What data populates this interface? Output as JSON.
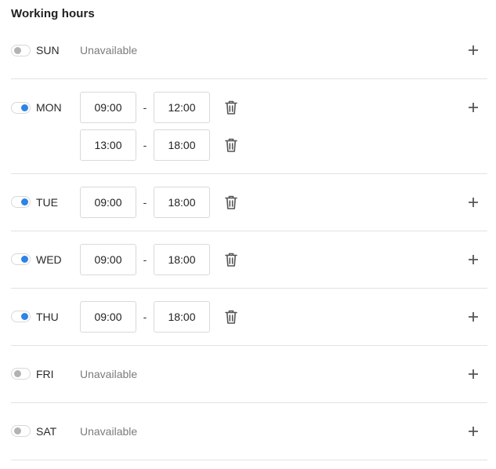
{
  "header": {
    "title": "Working hours"
  },
  "days": [
    {
      "label": "SUN",
      "enabled": false,
      "unavailable_text": "Unavailable",
      "slots": []
    },
    {
      "label": "MON",
      "enabled": true,
      "slots": [
        {
          "start": "09:00",
          "separator": "-",
          "end": "12:00"
        },
        {
          "start": "13:00",
          "separator": "-",
          "end": "18:00"
        }
      ]
    },
    {
      "label": "TUE",
      "enabled": true,
      "slots": [
        {
          "start": "09:00",
          "separator": "-",
          "end": "18:00"
        }
      ]
    },
    {
      "label": "WED",
      "enabled": true,
      "slots": [
        {
          "start": "09:00",
          "separator": "-",
          "end": "18:00"
        }
      ]
    },
    {
      "label": "THU",
      "enabled": true,
      "slots": [
        {
          "start": "09:00",
          "separator": "-",
          "end": "18:00"
        }
      ]
    },
    {
      "label": "FRI",
      "enabled": false,
      "unavailable_text": "Unavailable",
      "slots": []
    },
    {
      "label": "SAT",
      "enabled": false,
      "unavailable_text": "Unavailable",
      "slots": []
    }
  ],
  "icons": {
    "delete": "trash-icon",
    "add": "plus-icon"
  },
  "colors": {
    "toggle_on": "#2d83e6",
    "toggle_off": "#b3b3b3",
    "divider": "#e2e2e2"
  }
}
